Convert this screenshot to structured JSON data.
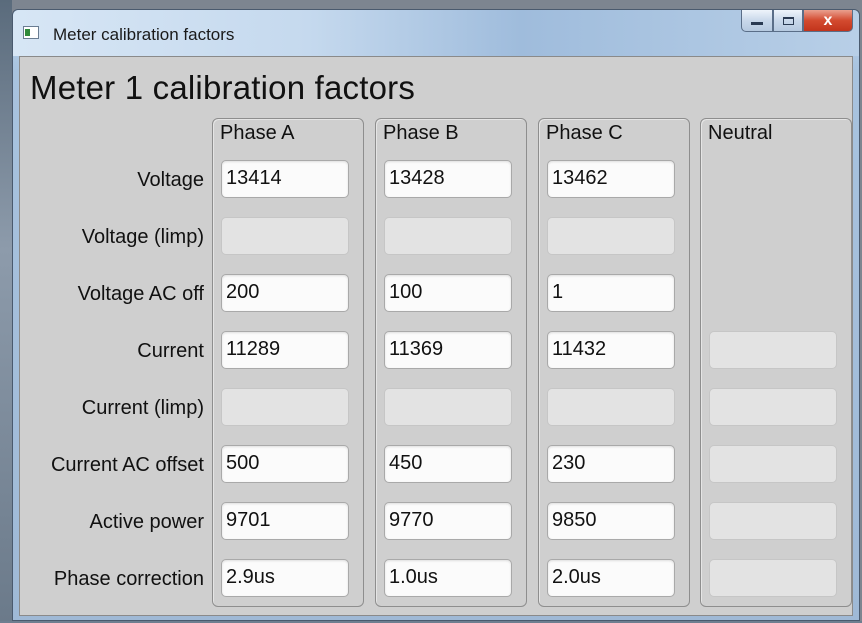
{
  "window": {
    "title": "Meter calibration factors",
    "controls": {
      "minimize": "minimize-icon",
      "maximize": "maximize-icon",
      "close_label": "x"
    }
  },
  "heading": "Meter 1 calibration factors",
  "columns": [
    {
      "label": "Phase A"
    },
    {
      "label": "Phase B"
    },
    {
      "label": "Phase C"
    },
    {
      "label": "Neutral"
    }
  ],
  "rows": [
    {
      "label": "Voltage",
      "values": [
        "13414",
        "13428",
        "13462",
        null
      ]
    },
    {
      "label": "Voltage (limp)",
      "values": [
        "",
        "",
        "",
        null
      ]
    },
    {
      "label": "Voltage AC off",
      "values": [
        "200",
        "100",
        "1",
        null
      ]
    },
    {
      "label": "Current",
      "values": [
        "11289",
        "11369",
        "11432",
        ""
      ]
    },
    {
      "label": "Current (limp)",
      "values": [
        "",
        "",
        "",
        ""
      ]
    },
    {
      "label": "Current AC offset",
      "values": [
        "500",
        "450",
        "230",
        ""
      ]
    },
    {
      "label": "Active power",
      "values": [
        "9701",
        "9770",
        "9850",
        ""
      ]
    },
    {
      "label": "Phase correction",
      "values": [
        "2.9us",
        "1.0us",
        "2.0us",
        ""
      ]
    }
  ],
  "disabled_fields": {
    "Voltage (limp)": [
      true,
      true,
      true,
      false
    ],
    "Current (limp)": [
      true,
      true,
      true,
      true
    ],
    "Neutral": [
      false,
      false,
      false,
      true
    ]
  },
  "colors": {
    "close_button": "#c2341c",
    "client_bg": "#cfcfcf",
    "field_bg": "#fbfbfb",
    "field_disabled_bg": "#e3e3e3"
  }
}
